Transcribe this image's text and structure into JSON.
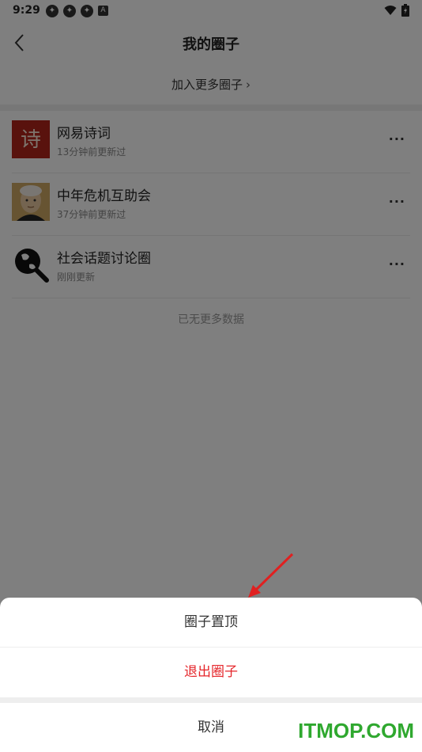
{
  "status": {
    "time": "9:29",
    "icons": [
      "app-icon",
      "app-icon",
      "app-icon",
      "a-icon"
    ],
    "right_icons": [
      "wifi-icon",
      "battery-icon"
    ]
  },
  "header": {
    "title": "我的圈子",
    "back_icon": "chevron-left-icon"
  },
  "join": {
    "label": "加入更多圈子",
    "chevron": "chevron-right-icon"
  },
  "circles": [
    {
      "name": "网易诗词",
      "updated": "13分钟前更新过",
      "avatar_text": "诗"
    },
    {
      "name": "中年危机互助会",
      "updated": "37分钟前更新过"
    },
    {
      "name": "社会话题讨论圈",
      "updated": "刚刚更新"
    }
  ],
  "list_footer": "已无更多数据",
  "sheet": {
    "pin": "圈子置顶",
    "quit": "退出圈子",
    "cancel": "取消"
  },
  "colors": {
    "quit": "#e5262b",
    "watermark": "#2fa82f",
    "arrow": "#e02020"
  },
  "watermark": "ITMOP.COM"
}
